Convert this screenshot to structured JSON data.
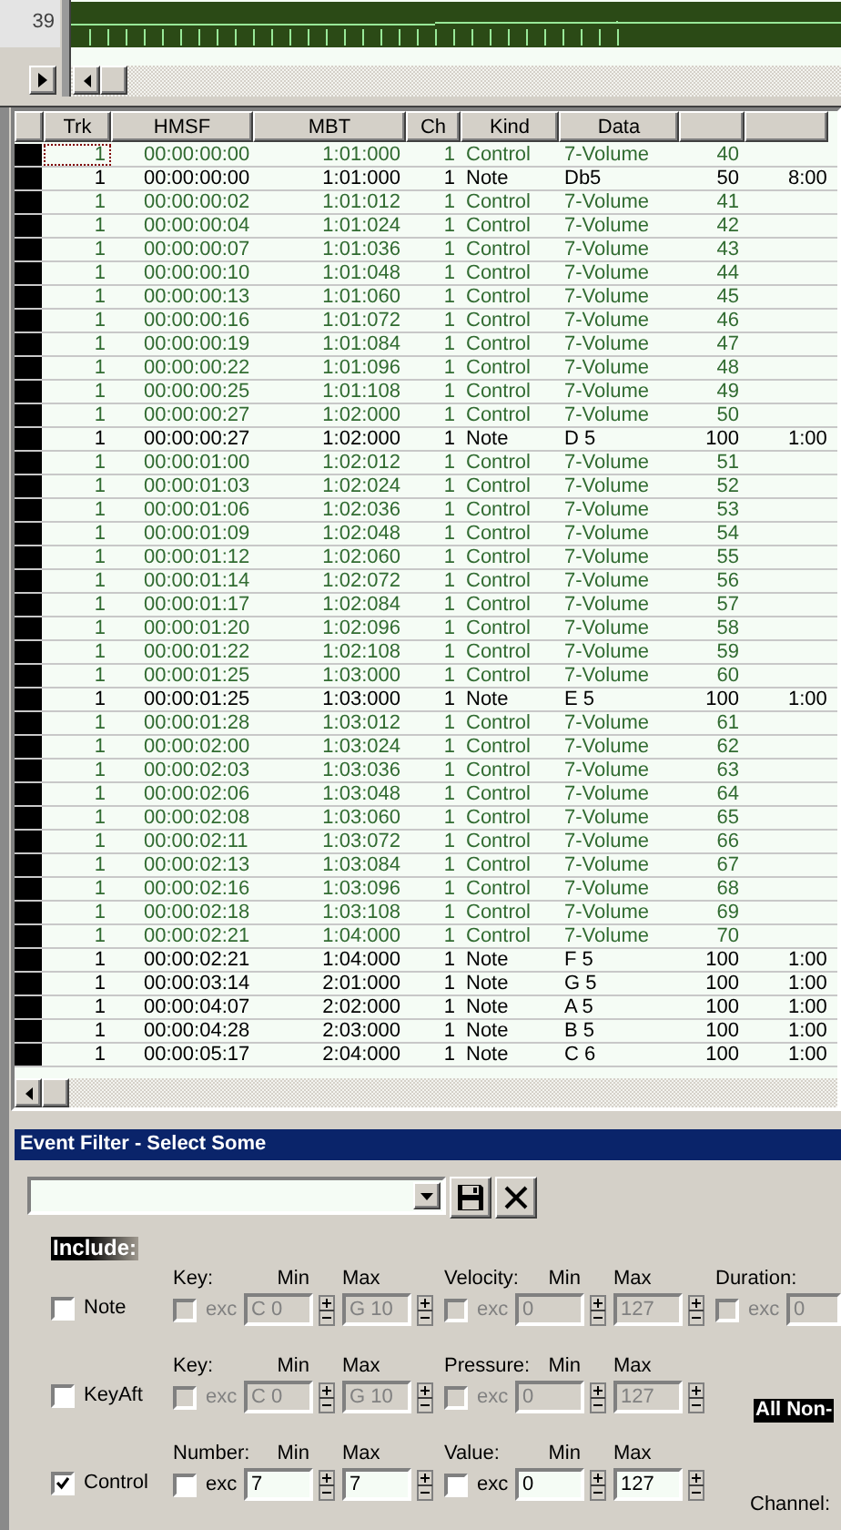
{
  "lane": {
    "number": "39"
  },
  "table": {
    "columns": [
      "Trk",
      "HMSF",
      "MBT",
      "Ch",
      "Kind",
      "Data"
    ],
    "rows": [
      {
        "color": "#316b31",
        "selected": true,
        "trk": "1",
        "hmsf": "00:00:00:00",
        "mbt": "1:01:000",
        "ch": "1",
        "kind": "Control",
        "data": "7-Volume",
        "column_7": "40"
      },
      {
        "color": "#000000",
        "selected": false,
        "trk": "1",
        "hmsf": "00:00:00:00",
        "mbt": "1:01:000",
        "ch": "1",
        "kind": "Note",
        "data": "Db5",
        "column_7": "50",
        "column_8": "8:00"
      },
      {
        "color": "#316b31",
        "selected": false,
        "trk": "1",
        "hmsf": "00:00:00:02",
        "mbt": "1:01:012",
        "ch": "1",
        "kind": "Control",
        "data": "7-Volume",
        "column_7": "41"
      },
      {
        "color": "#316b31",
        "selected": false,
        "trk": "1",
        "hmsf": "00:00:00:04",
        "mbt": "1:01:024",
        "ch": "1",
        "kind": "Control",
        "data": "7-Volume",
        "column_7": "42"
      },
      {
        "color": "#316b31",
        "selected": false,
        "trk": "1",
        "hmsf": "00:00:00:07",
        "mbt": "1:01:036",
        "ch": "1",
        "kind": "Control",
        "data": "7-Volume",
        "column_7": "43"
      },
      {
        "color": "#316b31",
        "selected": false,
        "trk": "1",
        "hmsf": "00:00:00:10",
        "mbt": "1:01:048",
        "ch": "1",
        "kind": "Control",
        "data": "7-Volume",
        "column_7": "44"
      },
      {
        "color": "#316b31",
        "selected": false,
        "trk": "1",
        "hmsf": "00:00:00:13",
        "mbt": "1:01:060",
        "ch": "1",
        "kind": "Control",
        "data": "7-Volume",
        "column_7": "45"
      },
      {
        "color": "#316b31",
        "selected": false,
        "trk": "1",
        "hmsf": "00:00:00:16",
        "mbt": "1:01:072",
        "ch": "1",
        "kind": "Control",
        "data": "7-Volume",
        "column_7": "46"
      },
      {
        "color": "#316b31",
        "selected": false,
        "trk": "1",
        "hmsf": "00:00:00:19",
        "mbt": "1:01:084",
        "ch": "1",
        "kind": "Control",
        "data": "7-Volume",
        "column_7": "47"
      },
      {
        "color": "#316b31",
        "selected": false,
        "trk": "1",
        "hmsf": "00:00:00:22",
        "mbt": "1:01:096",
        "ch": "1",
        "kind": "Control",
        "data": "7-Volume",
        "column_7": "48"
      },
      {
        "color": "#316b31",
        "selected": false,
        "trk": "1",
        "hmsf": "00:00:00:25",
        "mbt": "1:01:108",
        "ch": "1",
        "kind": "Control",
        "data": "7-Volume",
        "column_7": "49"
      },
      {
        "color": "#316b31",
        "selected": false,
        "trk": "1",
        "hmsf": "00:00:00:27",
        "mbt": "1:02:000",
        "ch": "1",
        "kind": "Control",
        "data": "7-Volume",
        "column_7": "50"
      },
      {
        "color": "#000000",
        "selected": false,
        "trk": "1",
        "hmsf": "00:00:00:27",
        "mbt": "1:02:000",
        "ch": "1",
        "kind": "Note",
        "data": "D 5",
        "column_7": "100",
        "column_8": "1:00"
      },
      {
        "color": "#316b31",
        "selected": false,
        "trk": "1",
        "hmsf": "00:00:01:00",
        "mbt": "1:02:012",
        "ch": "1",
        "kind": "Control",
        "data": "7-Volume",
        "column_7": "51"
      },
      {
        "color": "#316b31",
        "selected": false,
        "trk": "1",
        "hmsf": "00:00:01:03",
        "mbt": "1:02:024",
        "ch": "1",
        "kind": "Control",
        "data": "7-Volume",
        "column_7": "52"
      },
      {
        "color": "#316b31",
        "selected": false,
        "trk": "1",
        "hmsf": "00:00:01:06",
        "mbt": "1:02:036",
        "ch": "1",
        "kind": "Control",
        "data": "7-Volume",
        "column_7": "53"
      },
      {
        "color": "#316b31",
        "selected": false,
        "trk": "1",
        "hmsf": "00:00:01:09",
        "mbt": "1:02:048",
        "ch": "1",
        "kind": "Control",
        "data": "7-Volume",
        "column_7": "54"
      },
      {
        "color": "#316b31",
        "selected": false,
        "trk": "1",
        "hmsf": "00:00:01:12",
        "mbt": "1:02:060",
        "ch": "1",
        "kind": "Control",
        "data": "7-Volume",
        "column_7": "55"
      },
      {
        "color": "#316b31",
        "selected": false,
        "trk": "1",
        "hmsf": "00:00:01:14",
        "mbt": "1:02:072",
        "ch": "1",
        "kind": "Control",
        "data": "7-Volume",
        "column_7": "56"
      },
      {
        "color": "#316b31",
        "selected": false,
        "trk": "1",
        "hmsf": "00:00:01:17",
        "mbt": "1:02:084",
        "ch": "1",
        "kind": "Control",
        "data": "7-Volume",
        "column_7": "57"
      },
      {
        "color": "#316b31",
        "selected": false,
        "trk": "1",
        "hmsf": "00:00:01:20",
        "mbt": "1:02:096",
        "ch": "1",
        "kind": "Control",
        "data": "7-Volume",
        "column_7": "58"
      },
      {
        "color": "#316b31",
        "selected": false,
        "trk": "1",
        "hmsf": "00:00:01:22",
        "mbt": "1:02:108",
        "ch": "1",
        "kind": "Control",
        "data": "7-Volume",
        "column_7": "59"
      },
      {
        "color": "#316b31",
        "selected": false,
        "trk": "1",
        "hmsf": "00:00:01:25",
        "mbt": "1:03:000",
        "ch": "1",
        "kind": "Control",
        "data": "7-Volume",
        "column_7": "60"
      },
      {
        "color": "#000000",
        "selected": false,
        "trk": "1",
        "hmsf": "00:00:01:25",
        "mbt": "1:03:000",
        "ch": "1",
        "kind": "Note",
        "data": "E 5",
        "column_7": "100",
        "column_8": "1:00"
      },
      {
        "color": "#316b31",
        "selected": false,
        "trk": "1",
        "hmsf": "00:00:01:28",
        "mbt": "1:03:012",
        "ch": "1",
        "kind": "Control",
        "data": "7-Volume",
        "column_7": "61"
      },
      {
        "color": "#316b31",
        "selected": false,
        "trk": "1",
        "hmsf": "00:00:02:00",
        "mbt": "1:03:024",
        "ch": "1",
        "kind": "Control",
        "data": "7-Volume",
        "column_7": "62"
      },
      {
        "color": "#316b31",
        "selected": false,
        "trk": "1",
        "hmsf": "00:00:02:03",
        "mbt": "1:03:036",
        "ch": "1",
        "kind": "Control",
        "data": "7-Volume",
        "column_7": "63"
      },
      {
        "color": "#316b31",
        "selected": false,
        "trk": "1",
        "hmsf": "00:00:02:06",
        "mbt": "1:03:048",
        "ch": "1",
        "kind": "Control",
        "data": "7-Volume",
        "column_7": "64"
      },
      {
        "color": "#316b31",
        "selected": false,
        "trk": "1",
        "hmsf": "00:00:02:08",
        "mbt": "1:03:060",
        "ch": "1",
        "kind": "Control",
        "data": "7-Volume",
        "column_7": "65"
      },
      {
        "color": "#316b31",
        "selected": false,
        "trk": "1",
        "hmsf": "00:00:02:11",
        "mbt": "1:03:072",
        "ch": "1",
        "kind": "Control",
        "data": "7-Volume",
        "column_7": "66"
      },
      {
        "color": "#316b31",
        "selected": false,
        "trk": "1",
        "hmsf": "00:00:02:13",
        "mbt": "1:03:084",
        "ch": "1",
        "kind": "Control",
        "data": "7-Volume",
        "column_7": "67"
      },
      {
        "color": "#316b31",
        "selected": false,
        "trk": "1",
        "hmsf": "00:00:02:16",
        "mbt": "1:03:096",
        "ch": "1",
        "kind": "Control",
        "data": "7-Volume",
        "column_7": "68"
      },
      {
        "color": "#316b31",
        "selected": false,
        "trk": "1",
        "hmsf": "00:00:02:18",
        "mbt": "1:03:108",
        "ch": "1",
        "kind": "Control",
        "data": "7-Volume",
        "column_7": "69"
      },
      {
        "color": "#316b31",
        "selected": false,
        "trk": "1",
        "hmsf": "00:00:02:21",
        "mbt": "1:04:000",
        "ch": "1",
        "kind": "Control",
        "data": "7-Volume",
        "column_7": "70"
      },
      {
        "color": "#000000",
        "selected": false,
        "trk": "1",
        "hmsf": "00:00:02:21",
        "mbt": "1:04:000",
        "ch": "1",
        "kind": "Note",
        "data": "F 5",
        "column_7": "100",
        "column_8": "1:00"
      },
      {
        "color": "#000000",
        "selected": false,
        "trk": "1",
        "hmsf": "00:00:03:14",
        "mbt": "2:01:000",
        "ch": "1",
        "kind": "Note",
        "data": "G 5",
        "column_7": "100",
        "column_8": "1:00"
      },
      {
        "color": "#000000",
        "selected": false,
        "trk": "1",
        "hmsf": "00:00:04:07",
        "mbt": "2:02:000",
        "ch": "1",
        "kind": "Note",
        "data": "A 5",
        "column_7": "100",
        "column_8": "1:00"
      },
      {
        "color": "#000000",
        "selected": false,
        "trk": "1",
        "hmsf": "00:00:04:28",
        "mbt": "2:03:000",
        "ch": "1",
        "kind": "Note",
        "data": "B 5",
        "column_7": "100",
        "column_8": "1:00"
      },
      {
        "color": "#000000",
        "selected": false,
        "trk": "1",
        "hmsf": "00:00:05:17",
        "mbt": "2:04:000",
        "ch": "1",
        "kind": "Note",
        "data": "C 6",
        "column_7": "100",
        "column_8": "1:00"
      }
    ]
  },
  "filter": {
    "title": "Event Filter - Select Some",
    "include_label": "Include:",
    "rows": [
      {
        "label": "Note",
        "checked": false,
        "disabled": true,
        "groups": [
          {
            "label": "Key:",
            "min_label": "Min",
            "max_label": "Max",
            "exc": false,
            "exc_label": "exc",
            "min": "C 0",
            "max": "G 10"
          },
          {
            "label": "Velocity:",
            "min_label": "Min",
            "max_label": "Max",
            "exc": false,
            "exc_label": "exc",
            "min": "0",
            "max": "127"
          }
        ],
        "duration": {
          "label": "Duration:",
          "exc": false,
          "exc_label": "exc",
          "value": "0"
        }
      },
      {
        "label": "KeyAft",
        "checked": false,
        "disabled": true,
        "groups": [
          {
            "label": "Key:",
            "min_label": "Min",
            "max_label": "Max",
            "exc": false,
            "exc_label": "exc",
            "min": "C 0",
            "max": "G 10"
          },
          {
            "label": "Pressure:",
            "min_label": "Min",
            "max_label": "Max",
            "exc": false,
            "exc_label": "exc",
            "min": "0",
            "max": "127"
          }
        ]
      },
      {
        "label": "Control",
        "checked": true,
        "disabled": false,
        "groups": [
          {
            "label": "Number:",
            "min_label": "Min",
            "max_label": "Max",
            "exc": false,
            "exc_label": "exc",
            "min": "7",
            "max": "7"
          },
          {
            "label": "Value:",
            "min_label": "Min",
            "max_label": "Max",
            "exc": false,
            "exc_label": "exc",
            "min": "0",
            "max": "127"
          }
        ]
      }
    ],
    "all_non_label": "All Non-",
    "channel_label": "Channel:"
  }
}
